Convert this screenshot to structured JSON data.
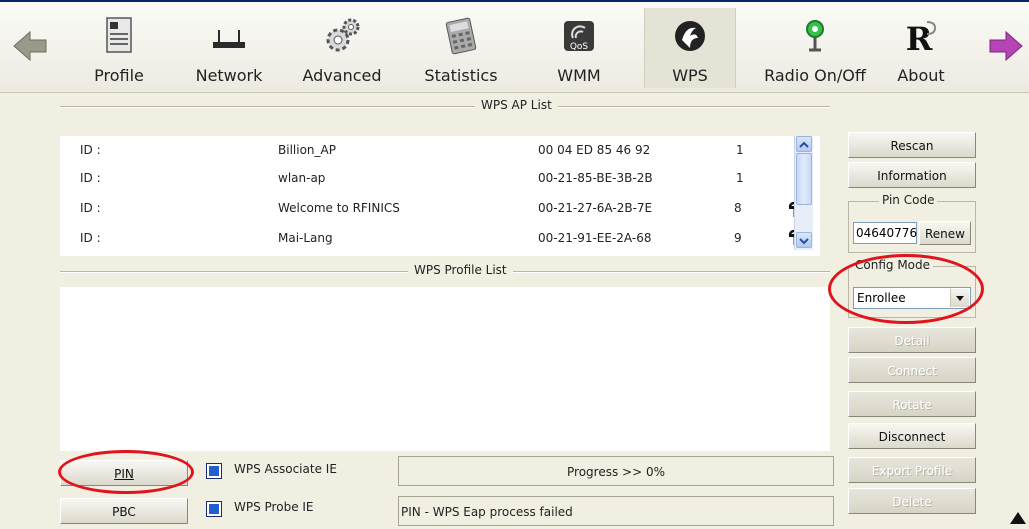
{
  "toolbar": {
    "items": [
      {
        "label": "Profile",
        "icon": "profile-icon"
      },
      {
        "label": "Network",
        "icon": "network-icon"
      },
      {
        "label": "Advanced",
        "icon": "advanced-gear-icon"
      },
      {
        "label": "Statistics",
        "icon": "statistics-calculator-icon"
      },
      {
        "label": "WMM",
        "icon": "qos-icon",
        "icon_text": "QoS"
      },
      {
        "label": "WPS",
        "icon": "wps-icon"
      },
      {
        "label": "Radio On/Off",
        "icon": "radio-antenna-icon"
      },
      {
        "label": "About",
        "icon": "about-r-icon",
        "icon_text": "R"
      }
    ],
    "active": "WPS",
    "back_icon": "back-arrow-icon",
    "forward_icon": "forward-arrow-icon"
  },
  "ap_list": {
    "title": "WPS AP List",
    "rows": [
      {
        "id_label": "ID :",
        "ssid": "Billion_AP",
        "bssid": "00 04 ED 85 46 92",
        "channel": "1",
        "lock": false
      },
      {
        "id_label": "ID :",
        "ssid": "wlan-ap",
        "bssid": "00-21-85-BE-3B-2B",
        "channel": "1",
        "lock": false
      },
      {
        "id_label": "ID :",
        "ssid": "Welcome to RFINICS",
        "bssid": "00-21-27-6A-2B-7E",
        "channel": "8",
        "lock": true
      },
      {
        "id_label": "ID :",
        "ssid": "Mai-Lang",
        "bssid": "00-21-91-EE-2A-68",
        "channel": "9",
        "lock": true
      }
    ]
  },
  "profile_list": {
    "title": "WPS Profile List"
  },
  "side": {
    "rescan": "Rescan",
    "information": "Information",
    "pin_code_legend": "Pin Code",
    "pin_code_value": "04640776",
    "renew": "Renew",
    "config_mode_legend": "Config Mode",
    "config_mode_value": "Enrollee",
    "detail": "Detail",
    "connect": "Connect",
    "rotate": "Rotate",
    "disconnect": "Disconnect",
    "export_profile": "Export Profile",
    "delete": "Delete"
  },
  "bottom": {
    "pin_button": "PIN",
    "pbc_button": "PBC",
    "assoc_ie_label": "WPS Associate IE",
    "probe_ie_label": "WPS Probe IE",
    "progress_text": "Progress >> 0%",
    "progress_value": 0,
    "status_text": "PIN - WPS Eap process failed"
  },
  "highlight_color": "#e0141c"
}
